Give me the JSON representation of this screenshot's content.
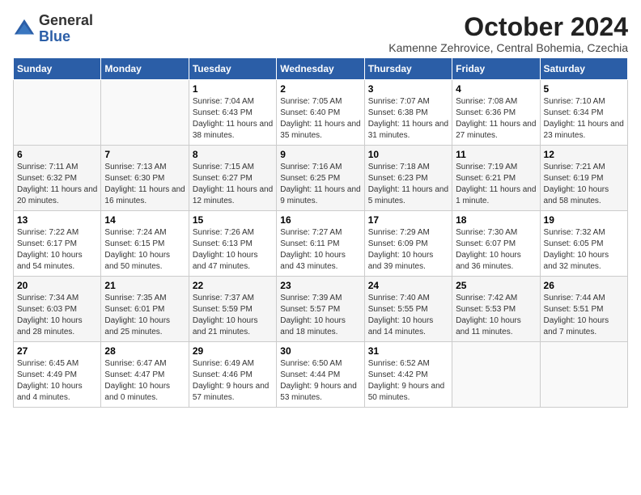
{
  "logo": {
    "general": "General",
    "blue": "Blue"
  },
  "header": {
    "month": "October 2024",
    "location": "Kamenne Zehrovice, Central Bohemia, Czechia"
  },
  "weekdays": [
    "Sunday",
    "Monday",
    "Tuesday",
    "Wednesday",
    "Thursday",
    "Friday",
    "Saturday"
  ],
  "weeks": [
    [
      {
        "day": "",
        "info": ""
      },
      {
        "day": "",
        "info": ""
      },
      {
        "day": "1",
        "info": "Sunrise: 7:04 AM\nSunset: 6:43 PM\nDaylight: 11 hours and 38 minutes."
      },
      {
        "day": "2",
        "info": "Sunrise: 7:05 AM\nSunset: 6:40 PM\nDaylight: 11 hours and 35 minutes."
      },
      {
        "day": "3",
        "info": "Sunrise: 7:07 AM\nSunset: 6:38 PM\nDaylight: 11 hours and 31 minutes."
      },
      {
        "day": "4",
        "info": "Sunrise: 7:08 AM\nSunset: 6:36 PM\nDaylight: 11 hours and 27 minutes."
      },
      {
        "day": "5",
        "info": "Sunrise: 7:10 AM\nSunset: 6:34 PM\nDaylight: 11 hours and 23 minutes."
      }
    ],
    [
      {
        "day": "6",
        "info": "Sunrise: 7:11 AM\nSunset: 6:32 PM\nDaylight: 11 hours and 20 minutes."
      },
      {
        "day": "7",
        "info": "Sunrise: 7:13 AM\nSunset: 6:30 PM\nDaylight: 11 hours and 16 minutes."
      },
      {
        "day": "8",
        "info": "Sunrise: 7:15 AM\nSunset: 6:27 PM\nDaylight: 11 hours and 12 minutes."
      },
      {
        "day": "9",
        "info": "Sunrise: 7:16 AM\nSunset: 6:25 PM\nDaylight: 11 hours and 9 minutes."
      },
      {
        "day": "10",
        "info": "Sunrise: 7:18 AM\nSunset: 6:23 PM\nDaylight: 11 hours and 5 minutes."
      },
      {
        "day": "11",
        "info": "Sunrise: 7:19 AM\nSunset: 6:21 PM\nDaylight: 11 hours and 1 minute."
      },
      {
        "day": "12",
        "info": "Sunrise: 7:21 AM\nSunset: 6:19 PM\nDaylight: 10 hours and 58 minutes."
      }
    ],
    [
      {
        "day": "13",
        "info": "Sunrise: 7:22 AM\nSunset: 6:17 PM\nDaylight: 10 hours and 54 minutes."
      },
      {
        "day": "14",
        "info": "Sunrise: 7:24 AM\nSunset: 6:15 PM\nDaylight: 10 hours and 50 minutes."
      },
      {
        "day": "15",
        "info": "Sunrise: 7:26 AM\nSunset: 6:13 PM\nDaylight: 10 hours and 47 minutes."
      },
      {
        "day": "16",
        "info": "Sunrise: 7:27 AM\nSunset: 6:11 PM\nDaylight: 10 hours and 43 minutes."
      },
      {
        "day": "17",
        "info": "Sunrise: 7:29 AM\nSunset: 6:09 PM\nDaylight: 10 hours and 39 minutes."
      },
      {
        "day": "18",
        "info": "Sunrise: 7:30 AM\nSunset: 6:07 PM\nDaylight: 10 hours and 36 minutes."
      },
      {
        "day": "19",
        "info": "Sunrise: 7:32 AM\nSunset: 6:05 PM\nDaylight: 10 hours and 32 minutes."
      }
    ],
    [
      {
        "day": "20",
        "info": "Sunrise: 7:34 AM\nSunset: 6:03 PM\nDaylight: 10 hours and 28 minutes."
      },
      {
        "day": "21",
        "info": "Sunrise: 7:35 AM\nSunset: 6:01 PM\nDaylight: 10 hours and 25 minutes."
      },
      {
        "day": "22",
        "info": "Sunrise: 7:37 AM\nSunset: 5:59 PM\nDaylight: 10 hours and 21 minutes."
      },
      {
        "day": "23",
        "info": "Sunrise: 7:39 AM\nSunset: 5:57 PM\nDaylight: 10 hours and 18 minutes."
      },
      {
        "day": "24",
        "info": "Sunrise: 7:40 AM\nSunset: 5:55 PM\nDaylight: 10 hours and 14 minutes."
      },
      {
        "day": "25",
        "info": "Sunrise: 7:42 AM\nSunset: 5:53 PM\nDaylight: 10 hours and 11 minutes."
      },
      {
        "day": "26",
        "info": "Sunrise: 7:44 AM\nSunset: 5:51 PM\nDaylight: 10 hours and 7 minutes."
      }
    ],
    [
      {
        "day": "27",
        "info": "Sunrise: 6:45 AM\nSunset: 4:49 PM\nDaylight: 10 hours and 4 minutes."
      },
      {
        "day": "28",
        "info": "Sunrise: 6:47 AM\nSunset: 4:47 PM\nDaylight: 10 hours and 0 minutes."
      },
      {
        "day": "29",
        "info": "Sunrise: 6:49 AM\nSunset: 4:46 PM\nDaylight: 9 hours and 57 minutes."
      },
      {
        "day": "30",
        "info": "Sunrise: 6:50 AM\nSunset: 4:44 PM\nDaylight: 9 hours and 53 minutes."
      },
      {
        "day": "31",
        "info": "Sunrise: 6:52 AM\nSunset: 4:42 PM\nDaylight: 9 hours and 50 minutes."
      },
      {
        "day": "",
        "info": ""
      },
      {
        "day": "",
        "info": ""
      }
    ]
  ]
}
